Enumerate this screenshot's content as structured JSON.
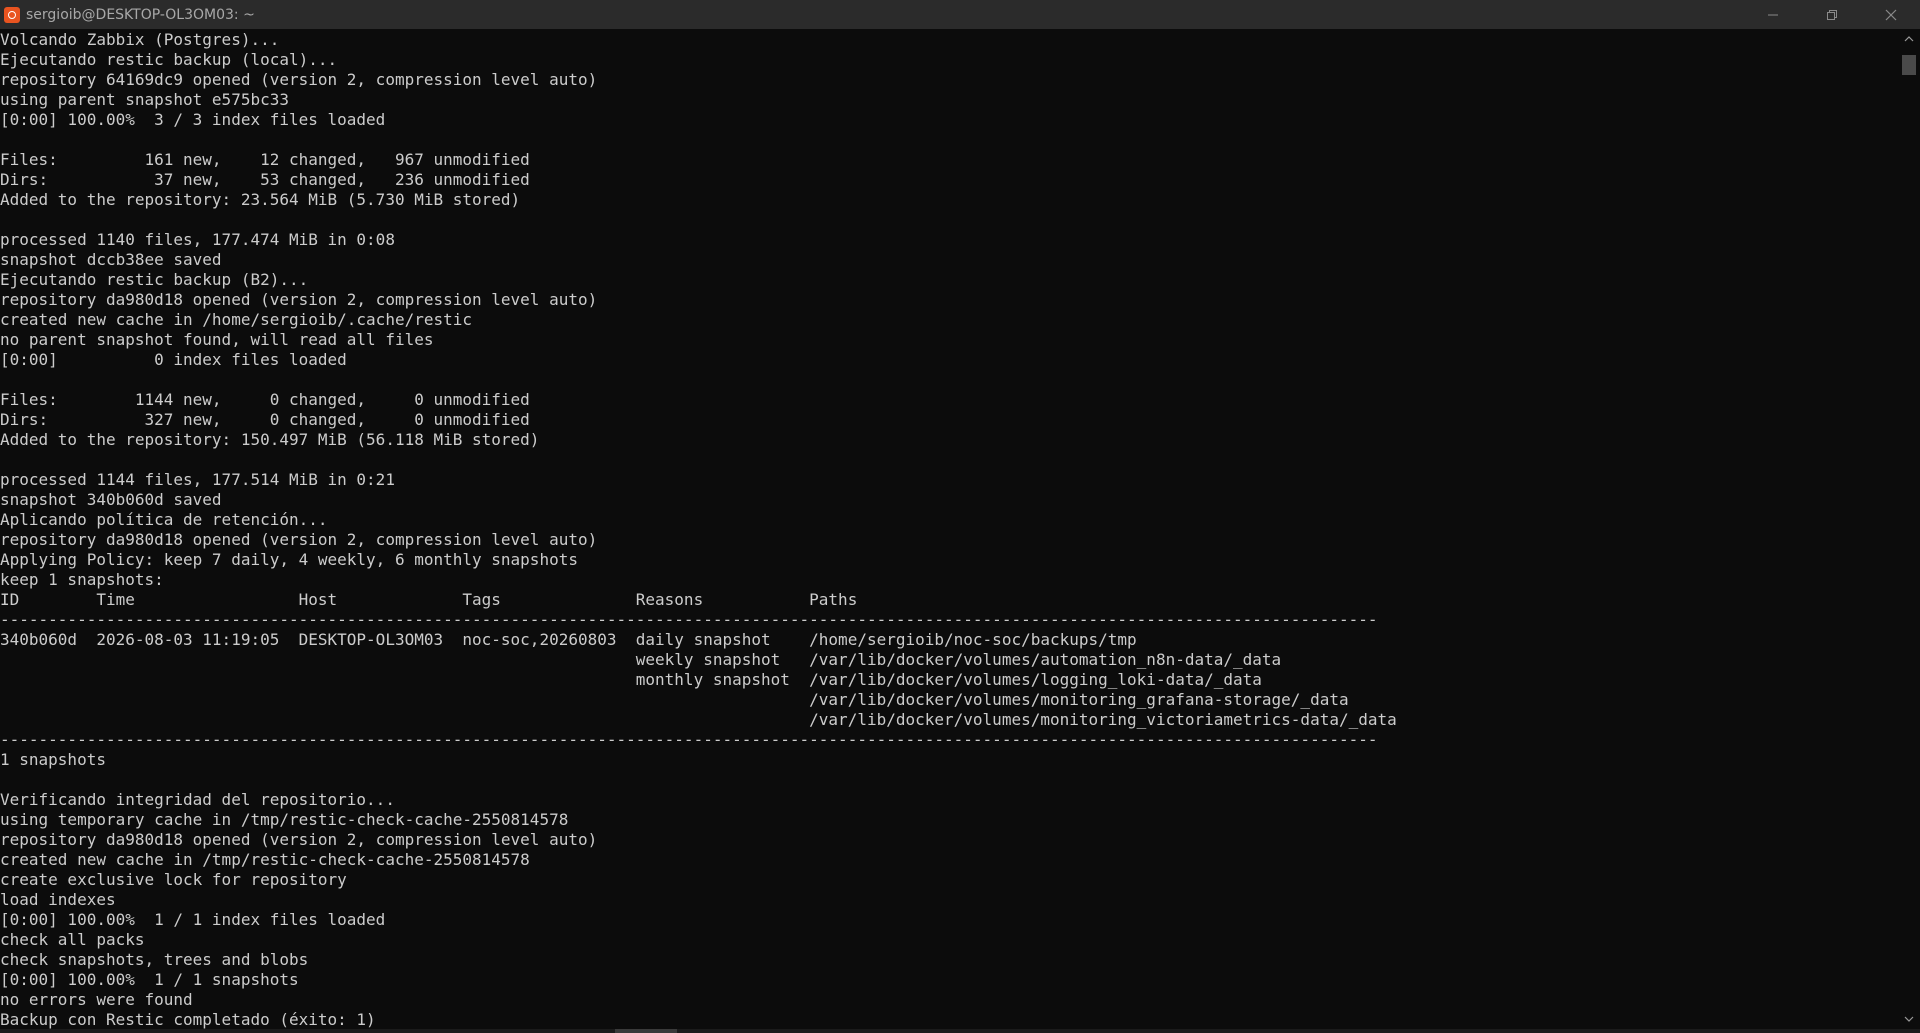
{
  "window": {
    "title": "sergioib@DESKTOP-OL3OM03: ~",
    "icon": "ubuntu-terminal-icon",
    "accent_color": "#e95420",
    "background_color": "#0c0c0c",
    "text_color": "#cccccc",
    "controls": {
      "minimize": "minimize-icon",
      "restore": "restore-icon",
      "close": "close-icon"
    }
  },
  "terminal": {
    "lines": [
      "Volcando Zabbix (Postgres)...",
      "Ejecutando restic backup (local)...",
      "repository 64169dc9 opened (version 2, compression level auto)",
      "using parent snapshot e575bc33",
      "[0:00] 100.00%  3 / 3 index files loaded",
      "",
      "Files:         161 new,    12 changed,   967 unmodified",
      "Dirs:           37 new,    53 changed,   236 unmodified",
      "Added to the repository: 23.564 MiB (5.730 MiB stored)",
      "",
      "processed 1140 files, 177.474 MiB in 0:08",
      "snapshot dccb38ee saved",
      "Ejecutando restic backup (B2)...",
      "repository da980d18 opened (version 2, compression level auto)",
      "created new cache in /home/sergioib/.cache/restic",
      "no parent snapshot found, will read all files",
      "[0:00]          0 index files loaded",
      "",
      "Files:        1144 new,     0 changed,     0 unmodified",
      "Dirs:          327 new,     0 changed,     0 unmodified",
      "Added to the repository: 150.497 MiB (56.118 MiB stored)",
      "",
      "processed 1144 files, 177.514 MiB in 0:21",
      "snapshot 340b060d saved",
      "Aplicando política de retención...",
      "repository da980d18 opened (version 2, compression level auto)",
      "Applying Policy: keep 7 daily, 4 weekly, 6 monthly snapshots",
      "keep 1 snapshots:",
      "ID        Time                 Host             Tags              Reasons           Paths",
      "-----------------------------------------------------------------------------------------------------------------------------------------------",
      "340b060d  2026-08-03 11:19:05  DESKTOP-OL3OM03  noc-soc,20260803  daily snapshot    /home/sergioib/noc-soc/backups/tmp",
      "                                                                  weekly snapshot   /var/lib/docker/volumes/automation_n8n-data/_data",
      "                                                                  monthly snapshot  /var/lib/docker/volumes/logging_loki-data/_data",
      "                                                                                    /var/lib/docker/volumes/monitoring_grafana-storage/_data",
      "                                                                                    /var/lib/docker/volumes/monitoring_victoriametrics-data/_data",
      "-----------------------------------------------------------------------------------------------------------------------------------------------",
      "1 snapshots",
      "",
      "Verificando integridad del repositorio...",
      "using temporary cache in /tmp/restic-check-cache-2550814578",
      "repository da980d18 opened (version 2, compression level auto)",
      "created new cache in /tmp/restic-check-cache-2550814578",
      "create exclusive lock for repository",
      "load indexes",
      "[0:00] 100.00%  1 / 1 index files loaded",
      "check all packs",
      "check snapshots, trees and blobs",
      "[0:00] 100.00%  1 / 1 snapshots",
      "no errors were found",
      "Backup con Restic completado (éxito: 1)"
    ]
  }
}
